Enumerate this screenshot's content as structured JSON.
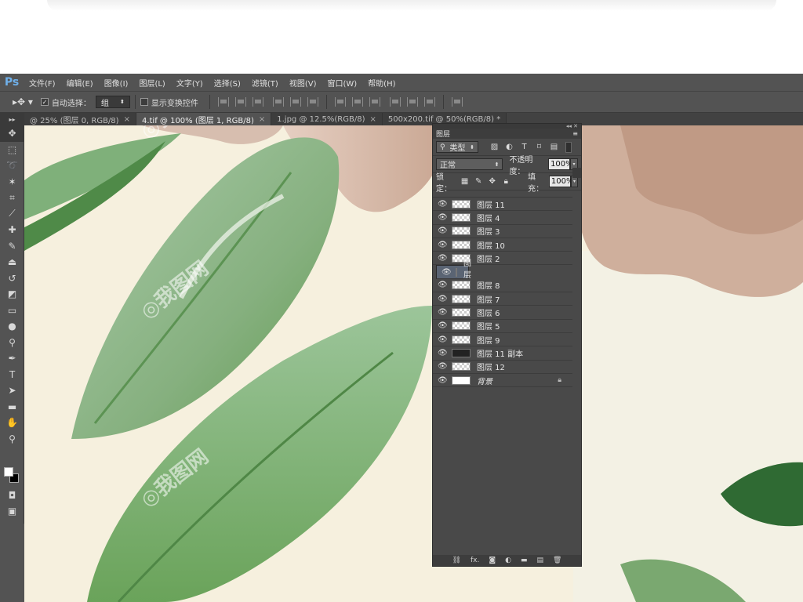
{
  "app": {
    "logo": "Ps"
  },
  "menu": [
    "文件(F)",
    "编辑(E)",
    "图像(I)",
    "图层(L)",
    "文字(Y)",
    "选择(S)",
    "滤镜(T)",
    "视图(V)",
    "窗口(W)",
    "帮助(H)"
  ],
  "options": {
    "auto_select_label": "自动选择：",
    "auto_select_value": "组",
    "transform_label": "显示变换控件"
  },
  "tabs": [
    {
      "label": "@ 25% (图层 0, RGB/8)",
      "close": "×"
    },
    {
      "label": "4.tif @ 100% (图层 1, RGB/8)",
      "close": "×"
    },
    {
      "label": "1.jpg @ 12.5%(RGB/8)",
      "close": "×"
    },
    {
      "label": "500x200.tif @ 50%(RGB/8) *",
      "close": "×"
    }
  ],
  "layers_panel": {
    "title": "图层",
    "filter_kind": "类型",
    "blend_mode": "正常",
    "opacity_label": "不透明度：",
    "opacity_value": "100%",
    "lock_label": "锁定：",
    "fill_label": "填充：",
    "fill_value": "100%",
    "layers": [
      {
        "name": "图层 11",
        "selected": false
      },
      {
        "name": "图层 4",
        "selected": false
      },
      {
        "name": "图层 3",
        "selected": false
      },
      {
        "name": "图层 10",
        "selected": false
      },
      {
        "name": "图层 2",
        "selected": false
      },
      {
        "name": "图层 1",
        "selected": true
      },
      {
        "name": "图层 8",
        "selected": false
      },
      {
        "name": "图层 7",
        "selected": false
      },
      {
        "name": "图层 6",
        "selected": false
      },
      {
        "name": "图层 5",
        "selected": false
      },
      {
        "name": "图层 9",
        "selected": false
      },
      {
        "name": "图层 11 副本",
        "selected": false
      },
      {
        "name": "图层 12",
        "selected": false
      },
      {
        "name": "背景",
        "selected": false
      }
    ],
    "footer_icons": [
      "link-icon",
      "fx-icon",
      "mask-icon",
      "adjustment-icon",
      "folder-icon",
      "new-layer-icon",
      "trash-icon"
    ]
  },
  "colors": {
    "panel": "#535353",
    "selected_layer": "#5a6473",
    "logo": "#6fb0ea"
  }
}
